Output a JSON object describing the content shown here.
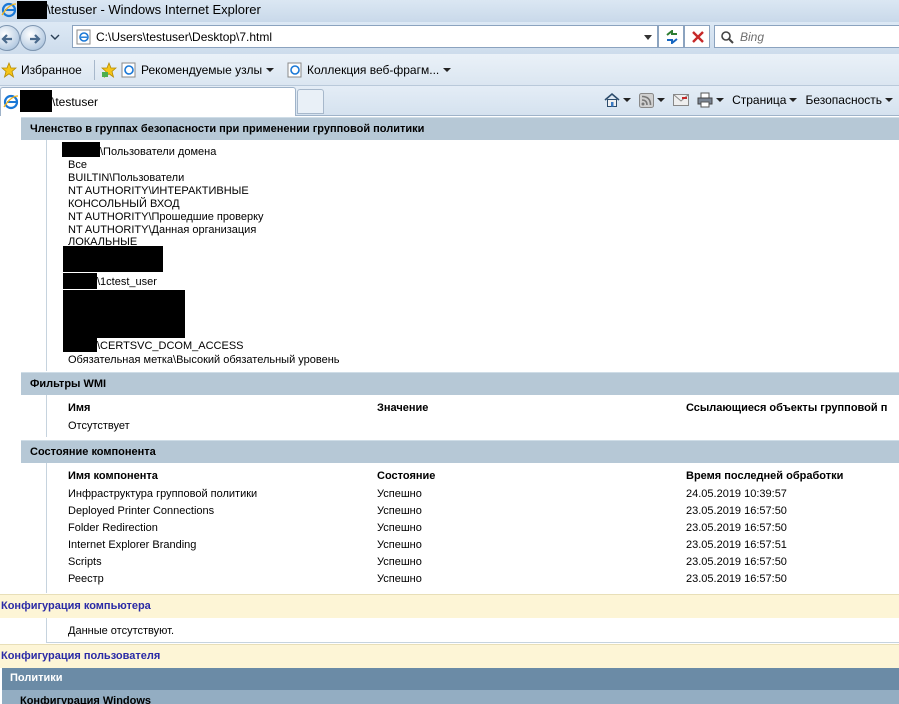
{
  "window": {
    "title_suffix": "\\testuser - Windows Internet Explorer"
  },
  "address_bar": {
    "url": "C:\\Users\\testuser\\Desktop\\7.html",
    "search_placeholder": "Bing"
  },
  "favorites_bar": {
    "favorites_label": "Избранное",
    "recommended_label": "Рекомендуемые узлы",
    "gallery_label": "Коллекция веб-фрагм..."
  },
  "tabs": {
    "active_label": "\\testuser"
  },
  "command_bar": {
    "page_label": "Страница",
    "security_label": "Безопасность"
  },
  "report": {
    "security_groups": {
      "header": "Членство в группах безопасности при применении групповой политики",
      "entries": [
        "\\Пользователи домена",
        "Все",
        "BUILTIN\\Пользователи",
        "NT AUTHORITY\\ИНТЕРАКТИВНЫЕ",
        "КОНСОЛЬНЫЙ ВХОД",
        "NT AUTHORITY\\Прошедшие проверку",
        "NT AUTHORITY\\Данная организация",
        "ЛОКАЛЬНЫЕ",
        "\\1ctest_user",
        "\\CERTSVC_DCOM_ACCESS",
        "Обязательная метка\\Высокий обязательный уровень"
      ]
    },
    "wmi_filters": {
      "header": "Фильтры WMI",
      "columns": [
        "Имя",
        "Значение",
        "Ссылающиеся объекты групповой п"
      ],
      "empty_text": "Отсутствует"
    },
    "component_status": {
      "header": "Состояние компонента",
      "columns": [
        "Имя компонента",
        "Состояние",
        "Время последней обработки"
      ],
      "rows": [
        [
          "Инфраструктура групповой политики",
          "Успешно",
          "24.05.2019 10:39:57"
        ],
        [
          "Deployed Printer Connections",
          "Успешно",
          "23.05.2019 16:57:50"
        ],
        [
          "Folder Redirection",
          "Успешно",
          "23.05.2019 16:57:50"
        ],
        [
          "Internet Explorer Branding",
          "Успешно",
          "23.05.2019 16:57:51"
        ],
        [
          "Scripts",
          "Успешно",
          "23.05.2019 16:57:50"
        ],
        [
          "Реестр",
          "Успешно",
          "23.05.2019 16:57:50"
        ]
      ]
    },
    "computer_config": {
      "header": "Конфигурация компьютера",
      "empty_text": "Данные отсутствуют."
    },
    "user_config": {
      "header": "Конфигурация пользователя",
      "policies_header": "Политики",
      "windows_config_header": "Конфигурация Windows"
    }
  },
  "colors": {
    "section_header_bg": "#b6c8d6",
    "config_header_bg": "#fdf5d6",
    "config_header_text": "#2a2aa6",
    "policies_header_bg": "#6b8ba6"
  }
}
